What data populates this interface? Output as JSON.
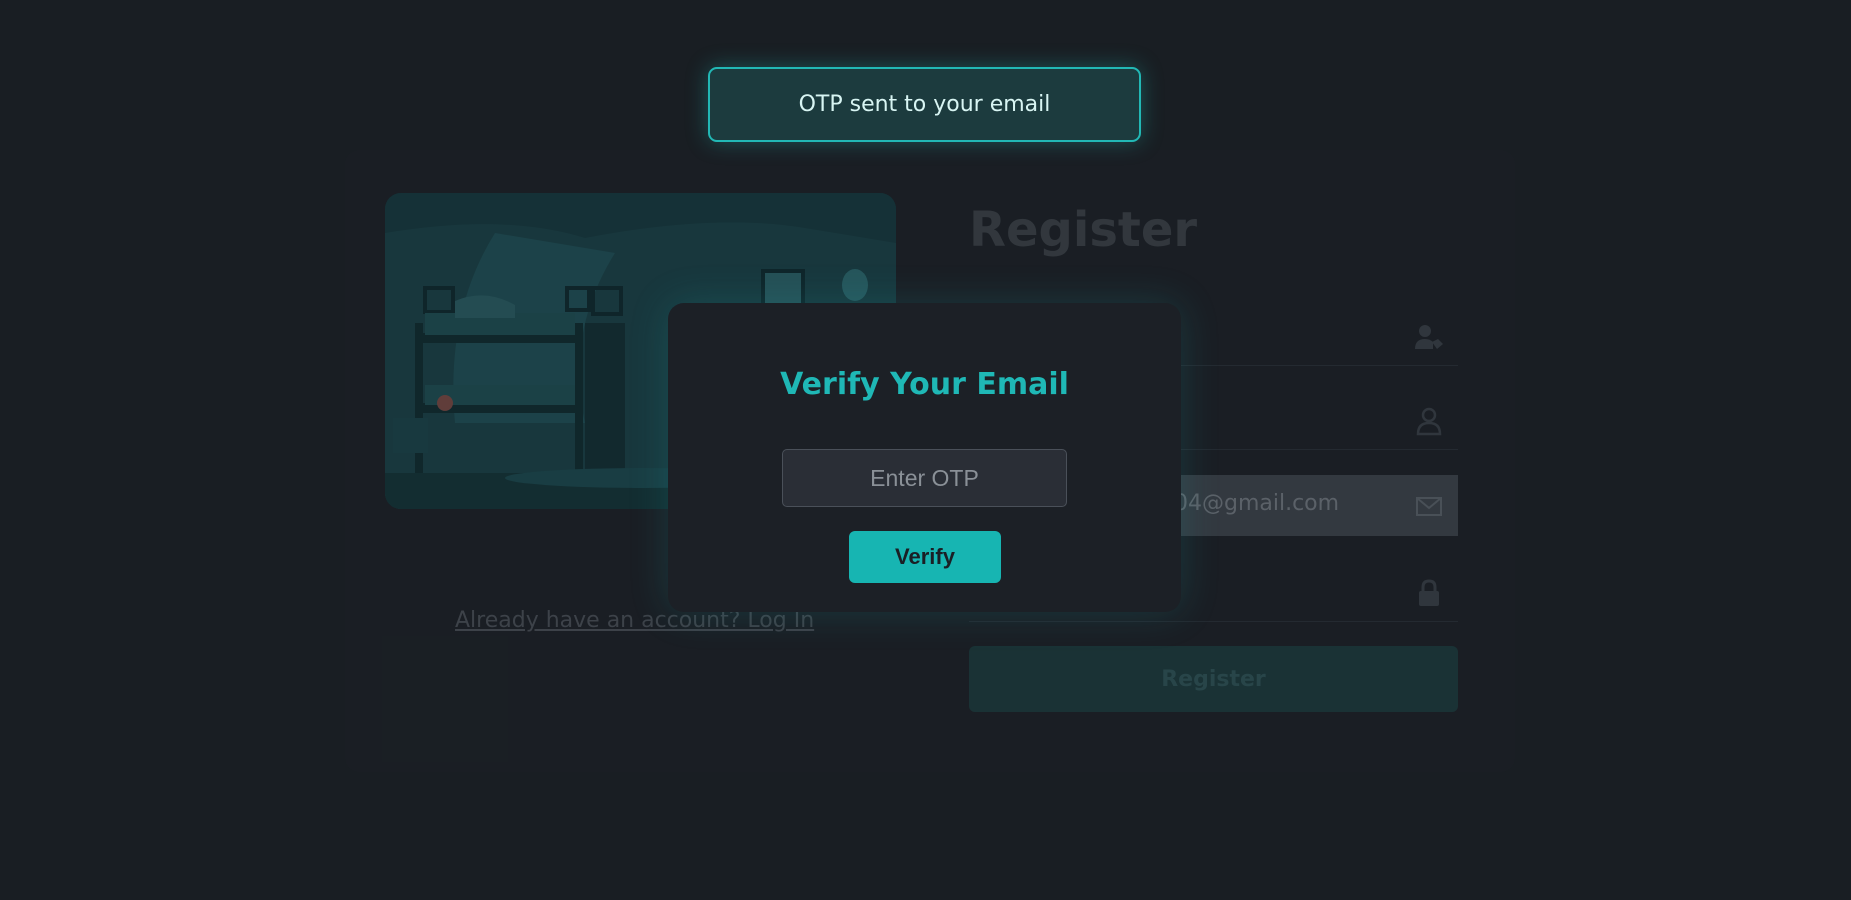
{
  "toast": {
    "message": "OTP sent to your email"
  },
  "background_form": {
    "title": "Register",
    "fields": [
      {
        "value": "",
        "icon": "user-tag-icon"
      },
      {
        "value": "",
        "icon": "user-icon"
      },
      {
        "value": "04@gmail.com",
        "icon": "envelope-icon"
      },
      {
        "value": "",
        "icon": "lock-icon"
      }
    ],
    "submit_label": "Register",
    "login_link": "Already have an account? Log In"
  },
  "modal": {
    "title": "Verify Your Email",
    "otp_placeholder": "Enter OTP",
    "verify_label": "Verify"
  },
  "colors": {
    "background": "#1b2026",
    "accent": "#1fb8b6",
    "modal_bg": "#1c2026",
    "toast_bg": "#1c3b3e"
  }
}
